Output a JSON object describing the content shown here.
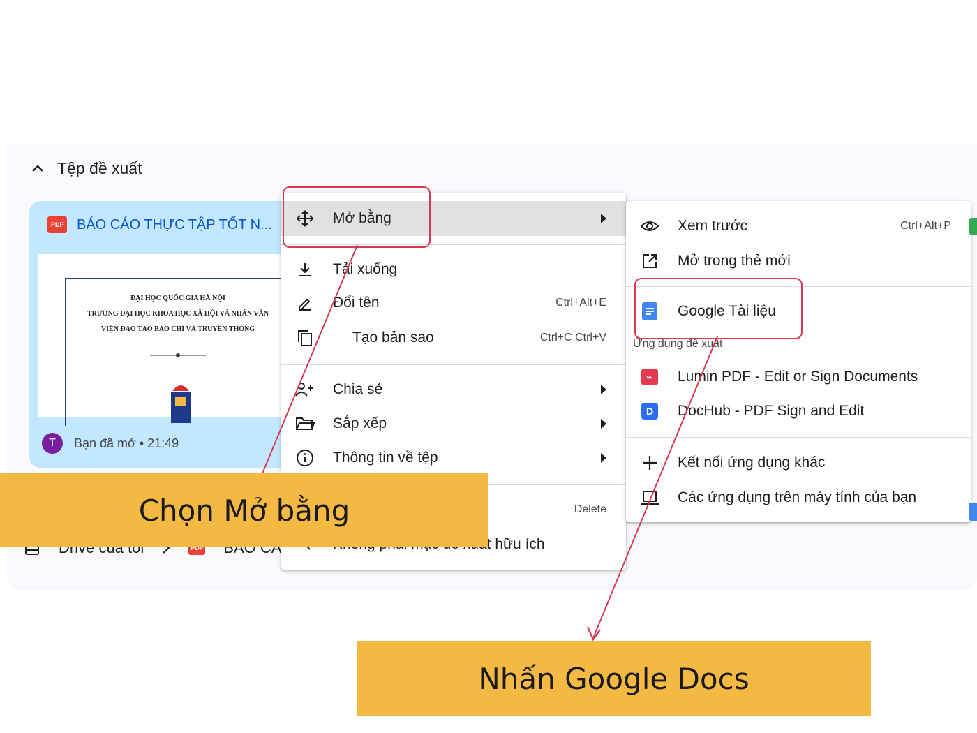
{
  "section": {
    "title": "Tệp đề xuất"
  },
  "card": {
    "file_badge": "PDF",
    "title": "BÁO CÁO THỰC TẬP TỐT N...",
    "doc_lines": [
      "ĐẠI HỌC QUỐC GIA HÀ NỘI",
      "TRƯỜNG ĐẠI HỌC KHOA HỌC XÃ HỘI VÀ NHÂN VĂN",
      "VIỆN ĐÀO TẠO BÁO CHÍ VÀ TRUYỀN THÔNG"
    ],
    "avatar_letter": "T",
    "meta": "Bạn đã mở • 21:49"
  },
  "breadcrumb": {
    "root": "Drive của tôi",
    "file": "BÁO CÁO"
  },
  "context_menu": {
    "open_with": "Mở bằng",
    "download": "Tải xuống",
    "rename": "Đổi tên",
    "rename_shortcut": "Ctrl+Alt+E",
    "copy": "Tạo bản sao",
    "copy_shortcut": "Ctrl+C Ctrl+V",
    "share": "Chia sẻ",
    "organize": "Sắp xếp",
    "file_info": "Thông tin về tệp",
    "delete_shortcut": "Delete",
    "not_helpful": "Không phải mục đề xuất hữu ích"
  },
  "submenu": {
    "preview": "Xem trước",
    "preview_shortcut": "Ctrl+Alt+P",
    "open_new_tab": "Mở trong thẻ mới",
    "google_docs": "Google Tài liệu",
    "suggested_apps_label": "Ứng dụng đề xuất",
    "lumin": "Lumin PDF - Edit or Sign Documents",
    "dochub": "DocHub - PDF Sign and Edit",
    "connect_more": "Kết nối ứng dụng khác",
    "desktop_apps": "Các ứng dụng trên máy tính của bạn"
  },
  "callouts": {
    "step1": "Chọn Mở bằng",
    "step2": "Nhấn Google Docs"
  },
  "colors": {
    "callout_bg": "#f4b942",
    "annotation_red": "#d83a52",
    "card_bg": "#c2e7ff",
    "link_blue": "#0b57d0"
  }
}
